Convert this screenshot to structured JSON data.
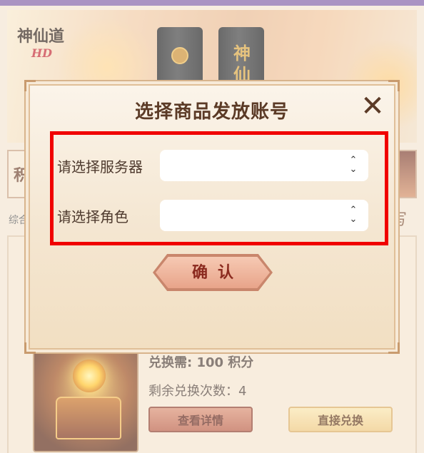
{
  "background": {
    "logo_text": "神仙道",
    "logo_sub": "HD",
    "lighter_script": "神仙道",
    "left_tab": "积",
    "left_label": "综合",
    "right_label": "写",
    "product": {
      "cost_line": "兑换需: 100 积分",
      "remaining_line": "剩余兑换次数：4",
      "details_button": "查看详情",
      "redeem_button": "直接兑换"
    }
  },
  "modal": {
    "title": "选择商品发放账号",
    "close_icon": "close-icon",
    "server": {
      "label": "请选择服务器",
      "value": ""
    },
    "role": {
      "label": "请选择角色",
      "value": ""
    },
    "confirm_label": "确认"
  },
  "colors": {
    "highlight": "#f00000",
    "title": "#5b3a26",
    "confirm_text": "#8b2a1f",
    "accent_purple": "#7c5aa4"
  }
}
